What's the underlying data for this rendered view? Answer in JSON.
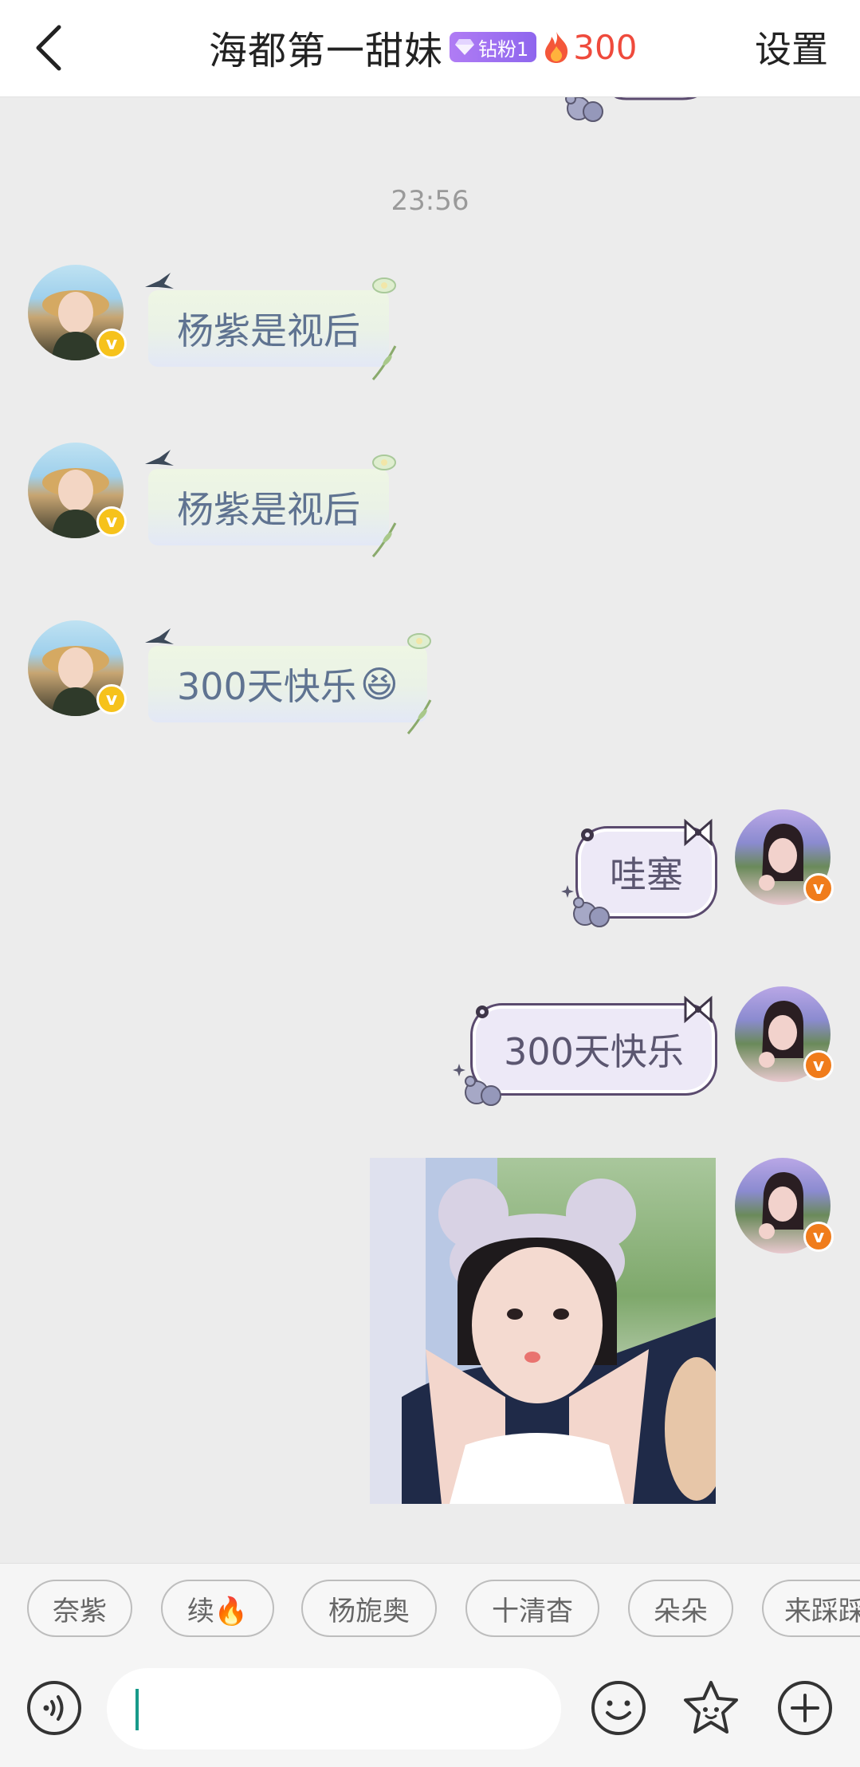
{
  "header": {
    "title": "海都第一甜妹",
    "fan_badge": "钻粉1",
    "fire_count": "300",
    "settings_label": "设置"
  },
  "chat": {
    "timestamp": "23:56",
    "messages": [
      {
        "side": "left",
        "text": "杨紫是视后"
      },
      {
        "side": "left",
        "text": "杨紫是视后"
      },
      {
        "side": "left",
        "text": "300天快乐",
        "emoji": "😆"
      },
      {
        "side": "right",
        "text": "哇塞"
      },
      {
        "side": "right",
        "text": "300天快乐"
      },
      {
        "side": "right",
        "type": "image"
      }
    ]
  },
  "chips": [
    "奈紫",
    "续🔥",
    "杨旎奥",
    "十清杳",
    "朵朵",
    "来踩踩"
  ],
  "input": {
    "value": ""
  },
  "colors": {
    "accent_fire": "#ef4a3c",
    "badge_purple": "#9b6ff1",
    "verify_yellow": "#f6c21b",
    "verify_orange": "#f07c1b",
    "caret": "#179a8a"
  }
}
